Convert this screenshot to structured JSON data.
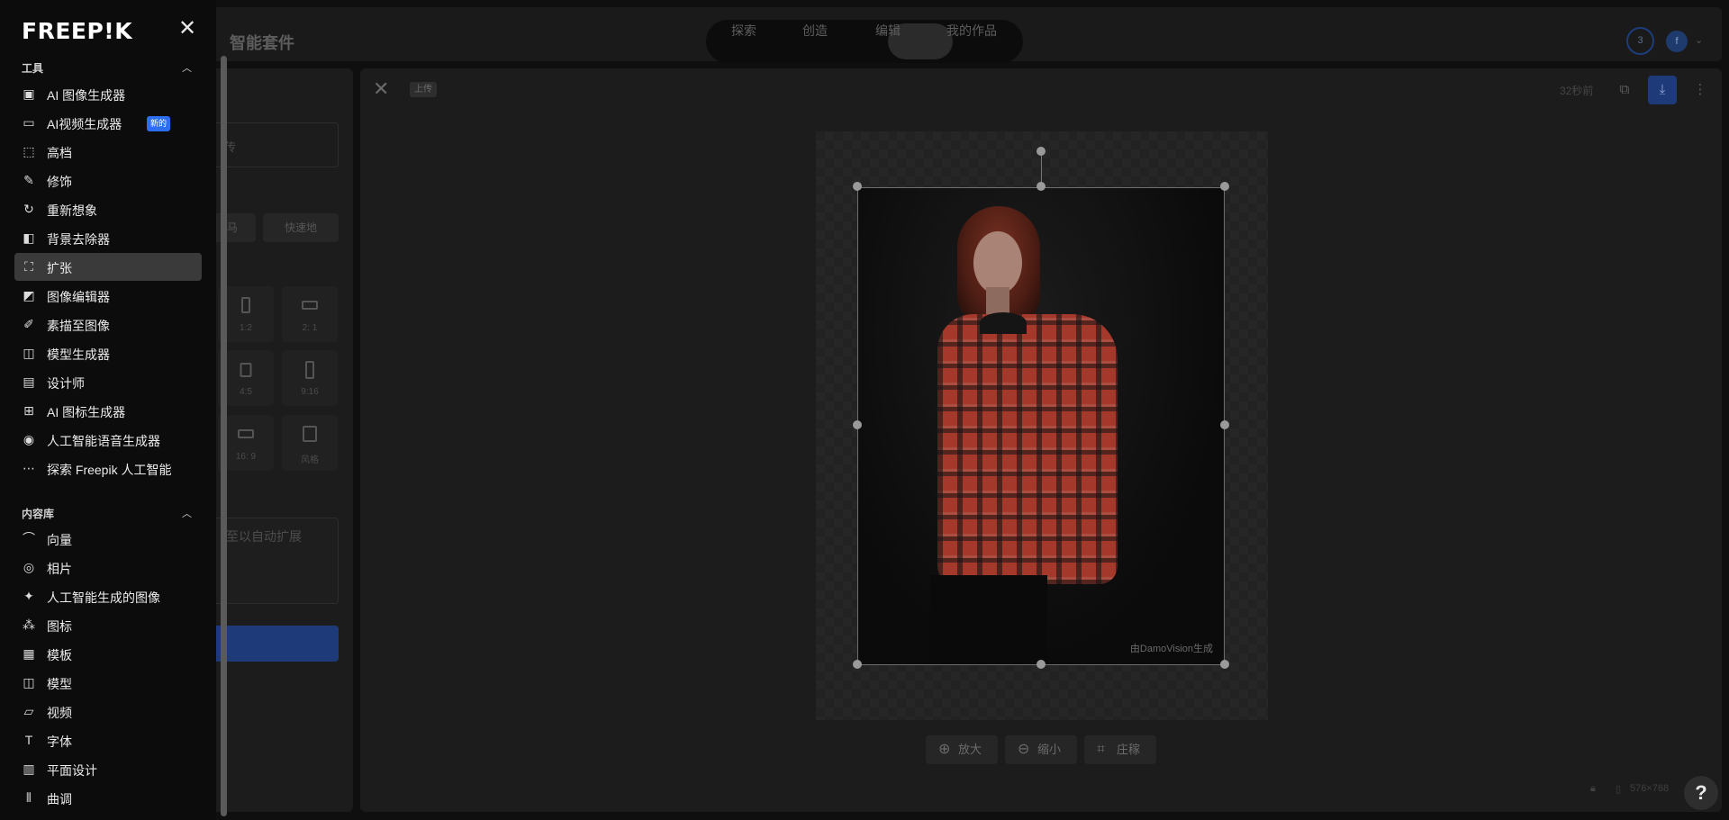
{
  "topbar": {
    "app_title": "智能套件",
    "nav_tabs": [
      "探索",
      "创造",
      "编辑",
      "我的作品"
    ],
    "credits_badge": "3",
    "user_initial": "f"
  },
  "settings": {
    "input_text_fragment": "传",
    "mode_left_fragment": "马",
    "mode_fast": "快速地",
    "ratios": [
      "1:2",
      "2: 1",
      "4:5",
      "9:16",
      "16: 9",
      "风格"
    ],
    "prompt_placeholder_fragment": "至以自动扩展"
  },
  "canvas": {
    "upload_tag": "上传",
    "time_ago": "32秒前",
    "watermark": "由DamoVision生成",
    "zoom_in": "放大",
    "zoom_out": "缩小",
    "crop": "庄稼",
    "dimensions": "576×768",
    "help": "?"
  },
  "sidebar": {
    "logo": "FREEP!K",
    "tools_title": "工具",
    "tools": [
      {
        "label": "AI 图像生成器",
        "icon": "image-generator-icon"
      },
      {
        "label": "AI视频生成器",
        "icon": "video-icon",
        "badge": "新的"
      },
      {
        "label": "高档",
        "icon": "upscale-icon"
      },
      {
        "label": "修饰",
        "icon": "retouch-icon"
      },
      {
        "label": "重新想象",
        "icon": "reimagine-icon"
      },
      {
        "label": "背景去除器",
        "icon": "background-remover-icon"
      },
      {
        "label": "扩张",
        "icon": "expand-icon",
        "active": true
      },
      {
        "label": "图像编辑器",
        "icon": "image-editor-icon"
      },
      {
        "label": "素描至图像",
        "icon": "sketch-icon"
      },
      {
        "label": "模型生成器",
        "icon": "mockup-icon"
      },
      {
        "label": "设计师",
        "icon": "designer-icon"
      },
      {
        "label": "AI 图标生成器",
        "icon": "icon-generator-icon"
      },
      {
        "label": "人工智能语音生成器",
        "icon": "voice-icon"
      },
      {
        "label": "探索 Freepik 人工智能",
        "icon": "more-dots-icon"
      }
    ],
    "library_title": "内容库",
    "library": [
      {
        "label": "向量",
        "icon": "vector-icon"
      },
      {
        "label": "相片",
        "icon": "camera-icon"
      },
      {
        "label": "人工智能生成的图像",
        "icon": "sparkle-icon"
      },
      {
        "label": "图标",
        "icon": "icons-icon"
      },
      {
        "label": "模板",
        "icon": "template-icon"
      },
      {
        "label": "模型",
        "icon": "mockup-icon"
      },
      {
        "label": "视频",
        "icon": "folder-video-icon"
      },
      {
        "label": "字体",
        "icon": "font-icon"
      },
      {
        "label": "平面设计",
        "icon": "psd-icon"
      },
      {
        "label": "曲调",
        "icon": "audio-icon"
      }
    ]
  }
}
